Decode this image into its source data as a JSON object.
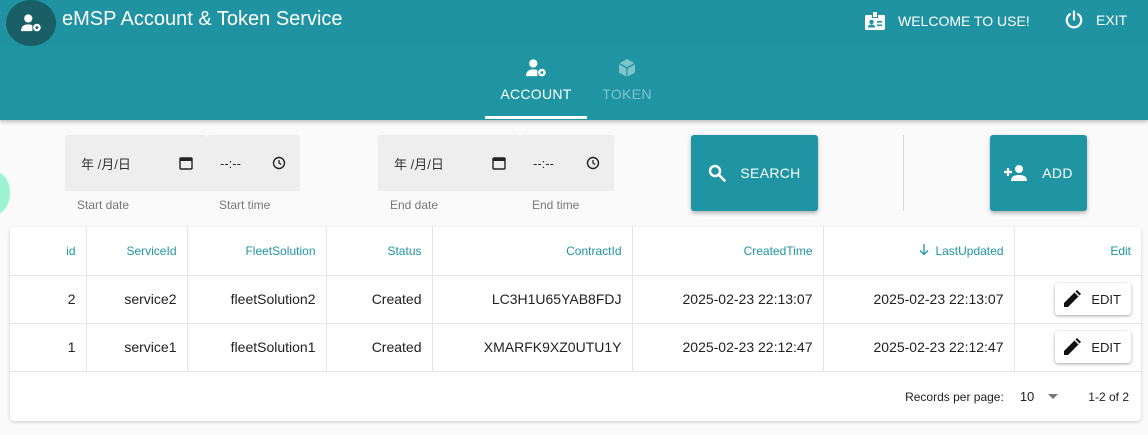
{
  "app": {
    "title": "eMSP Account & Token Service",
    "welcome_label": "WELCOME TO USE!",
    "exit_label": "EXIT"
  },
  "tabs": [
    {
      "label": "ACCOUNT",
      "icon": "account-settings-icon",
      "active": true
    },
    {
      "label": "TOKEN",
      "icon": "cube-icon",
      "active": false
    }
  ],
  "filters": {
    "start_date": {
      "value": "年 /月/日",
      "label": "Start date"
    },
    "start_time": {
      "value": "--:--",
      "label": "Start time"
    },
    "end_date": {
      "value": "年 /月/日",
      "label": "End date"
    },
    "end_time": {
      "value": "--:--",
      "label": "End time"
    }
  },
  "actions": {
    "search_label": "SEARCH",
    "add_label": "ADD"
  },
  "table": {
    "columns": [
      "id",
      "ServiceId",
      "FleetSolution",
      "Status",
      "ContractId",
      "CreatedTime",
      "LastUpdated",
      "Edit"
    ],
    "sort": {
      "column": "LastUpdated",
      "direction": "desc"
    },
    "rows": [
      {
        "id": "2",
        "service_id": "service2",
        "fleet_solution": "fleetSolution2",
        "status": "Created",
        "contract_id": "LC3H1U65YAB8FDJ",
        "created_time": "2025-02-23 22:13:07",
        "last_updated": "2025-02-23 22:13:07",
        "edit_label": "EDIT"
      },
      {
        "id": "1",
        "service_id": "service1",
        "fleet_solution": "fleetSolution1",
        "status": "Created",
        "contract_id": "XMARFK9XZ0UTU1Y",
        "created_time": "2025-02-23 22:12:47",
        "last_updated": "2025-02-23 22:12:47",
        "edit_label": "EDIT"
      }
    ]
  },
  "pagination": {
    "records_per_page_label": "Records per page:",
    "records_per_page": "10",
    "range": "1-2 of 2"
  },
  "colors": {
    "primary": "#1f95a3",
    "logo_bg": "#1a5f66",
    "fab_accent": "#9cf3d4"
  }
}
